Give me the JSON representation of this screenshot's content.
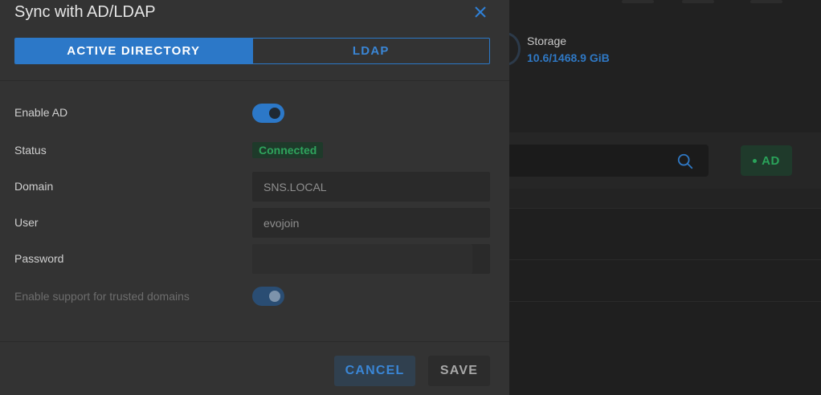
{
  "dialog": {
    "title": "Sync with AD/LDAP",
    "tabs": [
      {
        "label": "ACTIVE DIRECTORY",
        "active": true
      },
      {
        "label": "LDAP",
        "active": false
      }
    ],
    "fields": {
      "enable_ad": {
        "label": "Enable AD",
        "value": true
      },
      "status": {
        "label": "Status",
        "value": "Connected"
      },
      "domain": {
        "label": "Domain",
        "value": "SNS.LOCAL"
      },
      "user": {
        "label": "User",
        "value": "evojoin"
      },
      "password": {
        "label": "Password",
        "value": ""
      },
      "trusted_domains": {
        "label": "Enable support for trusted domains",
        "value": true,
        "disabled": true
      }
    },
    "buttons": {
      "cancel": "CANCEL",
      "save": "SAVE"
    }
  },
  "background": {
    "storage_label": "Storage",
    "storage_value": "10.6/1468.9 GiB",
    "ad_chip": "AD"
  },
  "colors": {
    "accent": "#2c78c8",
    "success": "#2fa45d",
    "dialog_bg": "#333333"
  }
}
